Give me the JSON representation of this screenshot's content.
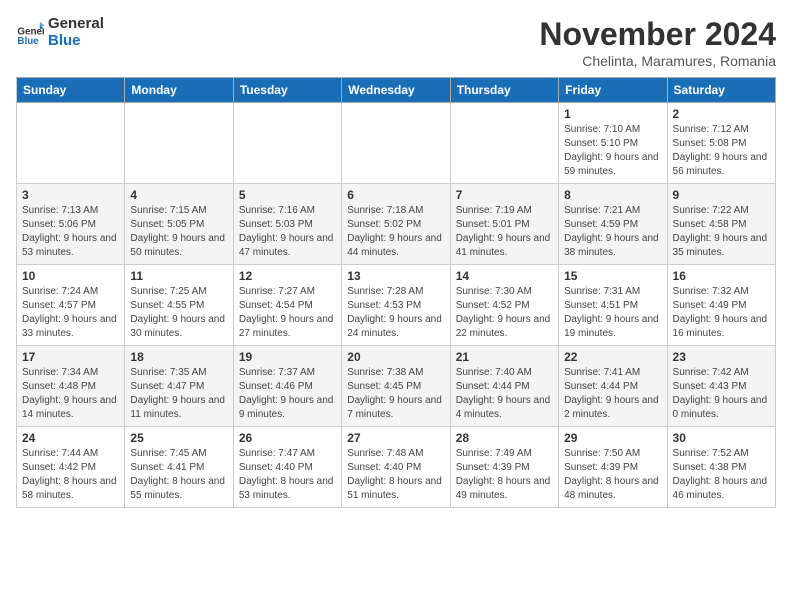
{
  "header": {
    "logo_line1": "General",
    "logo_line2": "Blue",
    "month": "November 2024",
    "location": "Chelinta, Maramures, Romania"
  },
  "weekdays": [
    "Sunday",
    "Monday",
    "Tuesday",
    "Wednesday",
    "Thursday",
    "Friday",
    "Saturday"
  ],
  "weeks": [
    [
      {
        "day": "",
        "info": ""
      },
      {
        "day": "",
        "info": ""
      },
      {
        "day": "",
        "info": ""
      },
      {
        "day": "",
        "info": ""
      },
      {
        "day": "",
        "info": ""
      },
      {
        "day": "1",
        "info": "Sunrise: 7:10 AM\nSunset: 5:10 PM\nDaylight: 9 hours and 59 minutes."
      },
      {
        "day": "2",
        "info": "Sunrise: 7:12 AM\nSunset: 5:08 PM\nDaylight: 9 hours and 56 minutes."
      }
    ],
    [
      {
        "day": "3",
        "info": "Sunrise: 7:13 AM\nSunset: 5:06 PM\nDaylight: 9 hours and 53 minutes."
      },
      {
        "day": "4",
        "info": "Sunrise: 7:15 AM\nSunset: 5:05 PM\nDaylight: 9 hours and 50 minutes."
      },
      {
        "day": "5",
        "info": "Sunrise: 7:16 AM\nSunset: 5:03 PM\nDaylight: 9 hours and 47 minutes."
      },
      {
        "day": "6",
        "info": "Sunrise: 7:18 AM\nSunset: 5:02 PM\nDaylight: 9 hours and 44 minutes."
      },
      {
        "day": "7",
        "info": "Sunrise: 7:19 AM\nSunset: 5:01 PM\nDaylight: 9 hours and 41 minutes."
      },
      {
        "day": "8",
        "info": "Sunrise: 7:21 AM\nSunset: 4:59 PM\nDaylight: 9 hours and 38 minutes."
      },
      {
        "day": "9",
        "info": "Sunrise: 7:22 AM\nSunset: 4:58 PM\nDaylight: 9 hours and 35 minutes."
      }
    ],
    [
      {
        "day": "10",
        "info": "Sunrise: 7:24 AM\nSunset: 4:57 PM\nDaylight: 9 hours and 33 minutes."
      },
      {
        "day": "11",
        "info": "Sunrise: 7:25 AM\nSunset: 4:55 PM\nDaylight: 9 hours and 30 minutes."
      },
      {
        "day": "12",
        "info": "Sunrise: 7:27 AM\nSunset: 4:54 PM\nDaylight: 9 hours and 27 minutes."
      },
      {
        "day": "13",
        "info": "Sunrise: 7:28 AM\nSunset: 4:53 PM\nDaylight: 9 hours and 24 minutes."
      },
      {
        "day": "14",
        "info": "Sunrise: 7:30 AM\nSunset: 4:52 PM\nDaylight: 9 hours and 22 minutes."
      },
      {
        "day": "15",
        "info": "Sunrise: 7:31 AM\nSunset: 4:51 PM\nDaylight: 9 hours and 19 minutes."
      },
      {
        "day": "16",
        "info": "Sunrise: 7:32 AM\nSunset: 4:49 PM\nDaylight: 9 hours and 16 minutes."
      }
    ],
    [
      {
        "day": "17",
        "info": "Sunrise: 7:34 AM\nSunset: 4:48 PM\nDaylight: 9 hours and 14 minutes."
      },
      {
        "day": "18",
        "info": "Sunrise: 7:35 AM\nSunset: 4:47 PM\nDaylight: 9 hours and 11 minutes."
      },
      {
        "day": "19",
        "info": "Sunrise: 7:37 AM\nSunset: 4:46 PM\nDaylight: 9 hours and 9 minutes."
      },
      {
        "day": "20",
        "info": "Sunrise: 7:38 AM\nSunset: 4:45 PM\nDaylight: 9 hours and 7 minutes."
      },
      {
        "day": "21",
        "info": "Sunrise: 7:40 AM\nSunset: 4:44 PM\nDaylight: 9 hours and 4 minutes."
      },
      {
        "day": "22",
        "info": "Sunrise: 7:41 AM\nSunset: 4:44 PM\nDaylight: 9 hours and 2 minutes."
      },
      {
        "day": "23",
        "info": "Sunrise: 7:42 AM\nSunset: 4:43 PM\nDaylight: 9 hours and 0 minutes."
      }
    ],
    [
      {
        "day": "24",
        "info": "Sunrise: 7:44 AM\nSunset: 4:42 PM\nDaylight: 8 hours and 58 minutes."
      },
      {
        "day": "25",
        "info": "Sunrise: 7:45 AM\nSunset: 4:41 PM\nDaylight: 8 hours and 55 minutes."
      },
      {
        "day": "26",
        "info": "Sunrise: 7:47 AM\nSunset: 4:40 PM\nDaylight: 8 hours and 53 minutes."
      },
      {
        "day": "27",
        "info": "Sunrise: 7:48 AM\nSunset: 4:40 PM\nDaylight: 8 hours and 51 minutes."
      },
      {
        "day": "28",
        "info": "Sunrise: 7:49 AM\nSunset: 4:39 PM\nDaylight: 8 hours and 49 minutes."
      },
      {
        "day": "29",
        "info": "Sunrise: 7:50 AM\nSunset: 4:39 PM\nDaylight: 8 hours and 48 minutes."
      },
      {
        "day": "30",
        "info": "Sunrise: 7:52 AM\nSunset: 4:38 PM\nDaylight: 8 hours and 46 minutes."
      }
    ]
  ]
}
